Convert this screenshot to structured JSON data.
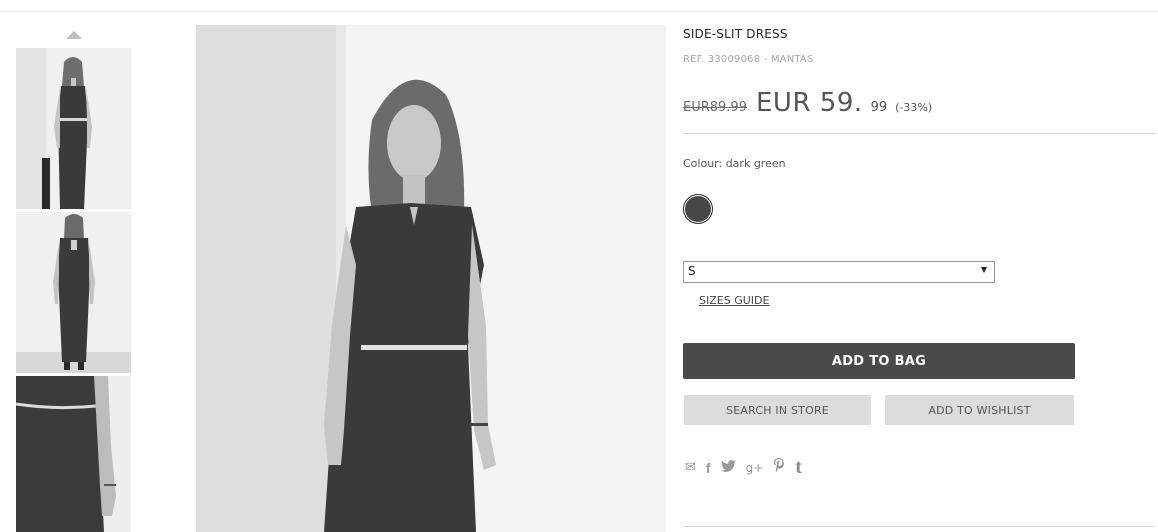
{
  "product": {
    "title": "SIDE-SLIT DRESS",
    "reference": "REF. 33009068 - MANTAS",
    "price": {
      "old": "EUR89.99",
      "current_main": "EUR 59.",
      "current_cents": "99",
      "discount": "(-33%)"
    },
    "colour_label": "Colour: dark green",
    "colour_swatch": "#474747",
    "size": {
      "selected": "S"
    },
    "sizes_guide": "SIZES GUIDE"
  },
  "actions": {
    "add_to_bag": "ADD TO BAG",
    "search_in_store": "SEARCH IN STORE",
    "add_to_wishlist": "ADD TO WISHLIST"
  },
  "share": {
    "icons": [
      "mail-icon",
      "facebook-icon",
      "twitter-icon",
      "google-plus-icon",
      "pinterest-icon",
      "tumblr-icon"
    ],
    "glyphs": {
      "mail": "✉",
      "facebook": "f",
      "twitter": "🐦",
      "google_plus": "g+",
      "pinterest": "℗",
      "tumblr": "t"
    }
  },
  "gallery": {
    "thumbnails": [
      "thumbnail-front-view",
      "thumbnail-back-view",
      "thumbnail-detail-view"
    ],
    "main_image": "model-wearing-dress"
  }
}
